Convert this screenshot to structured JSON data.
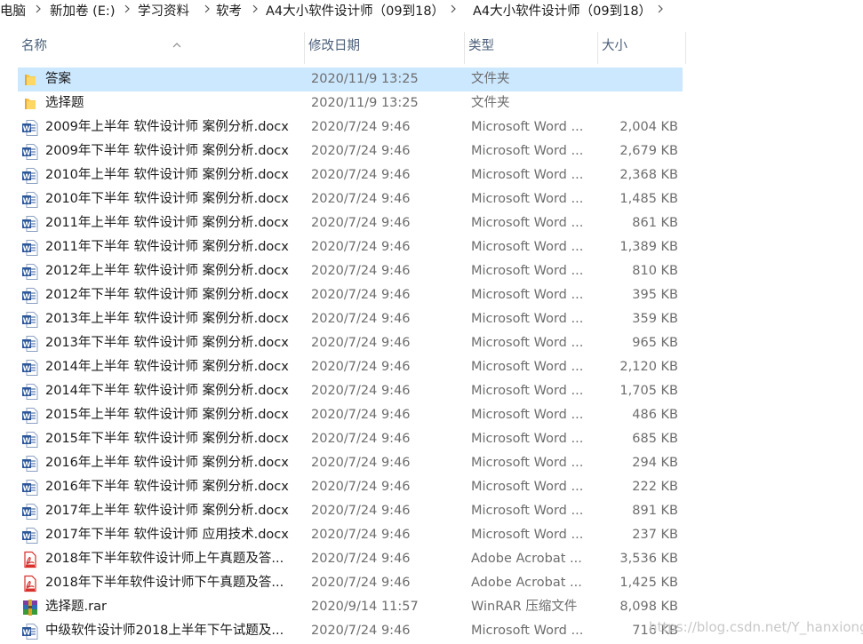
{
  "breadcrumb": [
    "电脑",
    "新加卷 (E:)",
    "学习资料",
    "软考",
    "A4大小软件设计师（09到18）",
    "A4大小软件设计师（09到18）"
  ],
  "columns": {
    "name": "名称",
    "date": "修改日期",
    "type": "类型",
    "size": "大小"
  },
  "sort": {
    "column": "name",
    "icon": "chevron-up-icon"
  },
  "colors": {
    "selected_row": "#cce8ff",
    "header_text": "#4c607a",
    "folder": "#f8c849",
    "word": "#2b579a",
    "pdf": "#d8302b"
  },
  "files": [
    {
      "name": "答案",
      "date": "2020/11/9 13:25",
      "type": "文件夹",
      "size": "",
      "icon": "folder-icon",
      "selected": true
    },
    {
      "name": "选择题",
      "date": "2020/11/9 13:25",
      "type": "文件夹",
      "size": "",
      "icon": "folder-icon"
    },
    {
      "name": "2009年上半年 软件设计师 案例分析.docx",
      "date": "2020/7/24 9:46",
      "type": "Microsoft Word ...",
      "size": "2,004 KB",
      "icon": "word-doc-icon"
    },
    {
      "name": "2009年下半年 软件设计师 案例分析.docx",
      "date": "2020/7/24 9:46",
      "type": "Microsoft Word ...",
      "size": "2,679 KB",
      "icon": "word-doc-icon"
    },
    {
      "name": "2010年上半年 软件设计师 案例分析.docx",
      "date": "2020/7/24 9:46",
      "type": "Microsoft Word ...",
      "size": "2,368 KB",
      "icon": "word-doc-icon"
    },
    {
      "name": "2010年下半年 软件设计师 案例分析.docx",
      "date": "2020/7/24 9:46",
      "type": "Microsoft Word ...",
      "size": "1,485 KB",
      "icon": "word-doc-icon"
    },
    {
      "name": "2011年上半年 软件设计师 案例分析.docx",
      "date": "2020/7/24 9:46",
      "type": "Microsoft Word ...",
      "size": "861 KB",
      "icon": "word-doc-icon"
    },
    {
      "name": "2011年下半年 软件设计师 案例分析.docx",
      "date": "2020/7/24 9:46",
      "type": "Microsoft Word ...",
      "size": "1,389 KB",
      "icon": "word-doc-icon"
    },
    {
      "name": "2012年上半年 软件设计师 案例分析.docx",
      "date": "2020/7/24 9:46",
      "type": "Microsoft Word ...",
      "size": "810 KB",
      "icon": "word-doc-icon"
    },
    {
      "name": "2012年下半年 软件设计师 案例分析.docx",
      "date": "2020/7/24 9:46",
      "type": "Microsoft Word ...",
      "size": "395 KB",
      "icon": "word-doc-icon"
    },
    {
      "name": "2013年上半年 软件设计师 案例分析.docx",
      "date": "2020/7/24 9:46",
      "type": "Microsoft Word ...",
      "size": "359 KB",
      "icon": "word-doc-icon"
    },
    {
      "name": "2013年下半年 软件设计师 案例分析.docx",
      "date": "2020/7/24 9:46",
      "type": "Microsoft Word ...",
      "size": "965 KB",
      "icon": "word-doc-icon"
    },
    {
      "name": "2014年上半年 软件设计师 案例分析.docx",
      "date": "2020/7/24 9:46",
      "type": "Microsoft Word ...",
      "size": "2,120 KB",
      "icon": "word-doc-icon"
    },
    {
      "name": "2014年下半年 软件设计师 案例分析.docx",
      "date": "2020/7/24 9:46",
      "type": "Microsoft Word ...",
      "size": "1,705 KB",
      "icon": "word-doc-icon"
    },
    {
      "name": "2015年上半年 软件设计师 案例分析.docx",
      "date": "2020/7/24 9:46",
      "type": "Microsoft Word ...",
      "size": "486 KB",
      "icon": "word-doc-icon"
    },
    {
      "name": "2015年下半年 软件设计师 案例分析.docx",
      "date": "2020/7/24 9:46",
      "type": "Microsoft Word ...",
      "size": "685 KB",
      "icon": "word-doc-icon"
    },
    {
      "name": "2016年上半年 软件设计师 案例分析.docx",
      "date": "2020/7/24 9:46",
      "type": "Microsoft Word ...",
      "size": "294 KB",
      "icon": "word-doc-icon"
    },
    {
      "name": "2016年下半年 软件设计师 案例分析.docx",
      "date": "2020/7/24 9:46",
      "type": "Microsoft Word ...",
      "size": "222 KB",
      "icon": "word-doc-icon"
    },
    {
      "name": "2017年上半年 软件设计师 案例分析.docx",
      "date": "2020/7/24 9:46",
      "type": "Microsoft Word ...",
      "size": "891 KB",
      "icon": "word-doc-icon"
    },
    {
      "name": "2017年下半年 软件设计师 应用技术.docx",
      "date": "2020/7/24 9:46",
      "type": "Microsoft Word ...",
      "size": "237 KB",
      "icon": "word-doc-icon"
    },
    {
      "name": "2018年下半年软件设计师上午真题及答...",
      "date": "2020/7/24 9:46",
      "type": "Adobe Acrobat ...",
      "size": "3,536 KB",
      "icon": "pdf-icon"
    },
    {
      "name": "2018年下半年软件设计师下午真题及答...",
      "date": "2020/7/24 9:46",
      "type": "Adobe Acrobat ...",
      "size": "1,425 KB",
      "icon": "pdf-icon"
    },
    {
      "name": "选择题.rar",
      "date": "2020/9/14 11:57",
      "type": "WinRAR 压缩文件",
      "size": "8,098 KB",
      "icon": "rar-archive-icon"
    },
    {
      "name": "中级软件设计师2018上半年下午试题及...",
      "date": "2020/7/24 9:46",
      "type": "Microsoft Word ...",
      "size": "716 KB",
      "icon": "word-doc-icon"
    }
  ],
  "watermark": "https://blog.csdn.net/Y_hanxiong"
}
